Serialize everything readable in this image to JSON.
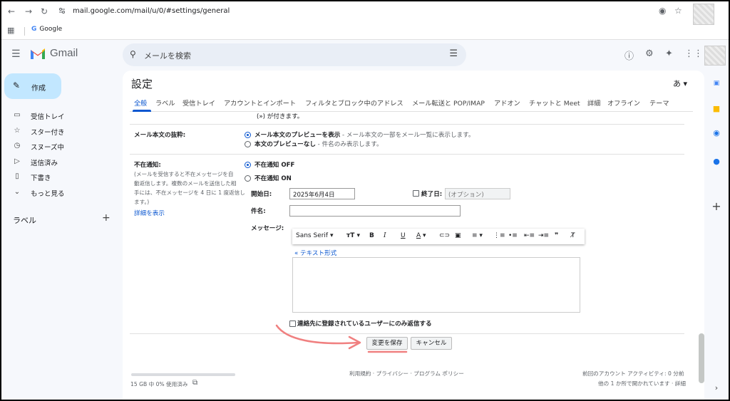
{
  "browser": {
    "url": "mail.google.com/mail/u/0/#settings/general",
    "bookmark_google": "Google"
  },
  "header": {
    "app_name": "Gmail",
    "search_placeholder": "メールを検索"
  },
  "sidebar": {
    "compose_label": "作成",
    "items": [
      {
        "label": "受信トレイ",
        "icon": "inbox-icon"
      },
      {
        "label": "スター付き",
        "icon": "star-icon"
      },
      {
        "label": "スヌーズ中",
        "icon": "clock-icon"
      },
      {
        "label": "送信済み",
        "icon": "send-icon"
      },
      {
        "label": "下書き",
        "icon": "draft-icon"
      },
      {
        "label": "もっと見る",
        "icon": "chevron-down-icon"
      }
    ],
    "labels_title": "ラベル"
  },
  "settings": {
    "title": "設定",
    "language_indicator": "あ",
    "tabs": [
      "全般",
      "ラベル",
      "受信トレイ",
      "アカウントとインポート",
      "フィルタとブロック中のアドレス",
      "メール転送と POP/IMAP",
      "アドオン",
      "チャットと Meet",
      "詳細",
      "オフライン",
      "テーマ"
    ],
    "partial_text": "(») が付きます。",
    "snippets": {
      "label": "メール本文の抜粋:",
      "option_show": "メール本文のプレビューを表示",
      "option_show_desc": " - メール本文の一部をメール一覧に表示します。",
      "option_hide": "本文のプレビューなし",
      "option_hide_desc": " - 件名のみ表示します。"
    },
    "vacation": {
      "label": "不在通知:",
      "desc_lines": [
        "(メールを受信すると不在メッセージを自",
        "動返信します。複数のメールを送信した相",
        "手には、不在メッセージを 4 日に 1 度返信し",
        "ます。)"
      ],
      "learn_more": "詳細を表示",
      "off_label": "不在通知 OFF",
      "on_label": "不在通知 ON",
      "start_label": "開始日:",
      "start_value": "2025年6月4日",
      "end_label": "終了日:",
      "end_placeholder": "(オプション)",
      "subject_label": "件名:",
      "message_label": "メッセージ:",
      "font_name": "Sans Serif",
      "plain_text_link": "« テキスト形式",
      "contacts_only": "連絡先に登録されているユーザーにのみ返信する"
    },
    "save_button": "変更を保存",
    "cancel_button": "キャンセル"
  },
  "footer": {
    "storage": "15 GB 中 0% 使用済み",
    "storage_used_fraction": 0.0,
    "links": "利用規約 · プライバシー · プログラム ポリシー",
    "activity_line1": "前回のアカウント アクティビティ: 0 分前",
    "activity_line2": "他の 1 か所で開かれています · 詳細"
  },
  "colors": {
    "accent": "#0b57d0",
    "compose_bg": "#c2e7ff",
    "annotation_arrow": "#f08080"
  }
}
